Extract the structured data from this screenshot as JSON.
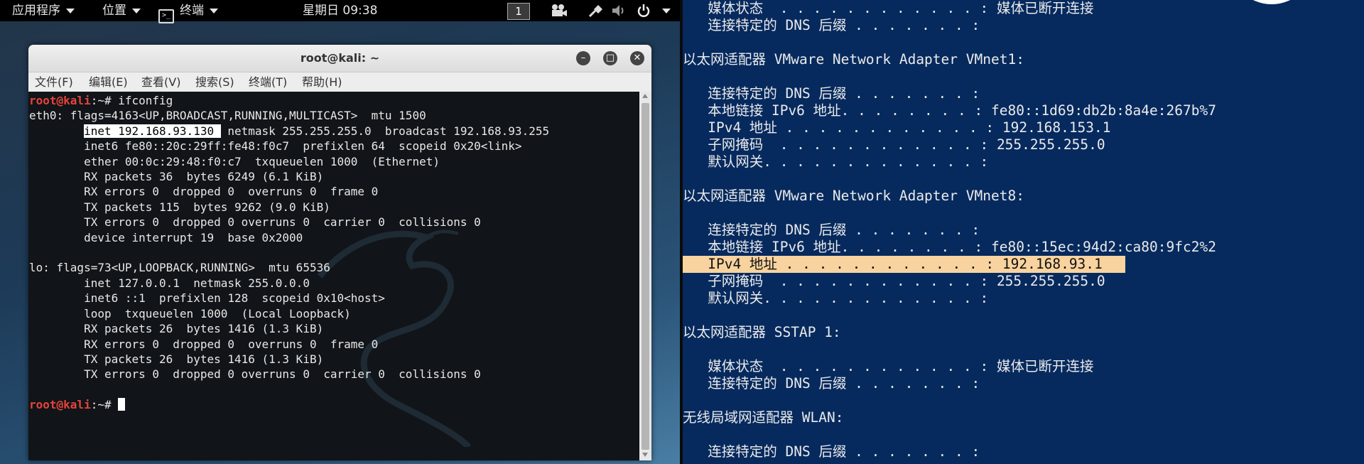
{
  "topbar": {
    "apps_label": "应用程序",
    "places_label": "位置",
    "terminal_label": "终端",
    "clock": "星期日 09:38",
    "workspace": "1"
  },
  "terminal": {
    "title": "root@kali: ~",
    "menu": [
      "文件(F)",
      "编辑(E)",
      "查看(V)",
      "搜索(S)",
      "终端(T)",
      "帮助(H)"
    ],
    "prompt_user": "root@kali",
    "prompt_suffix": ":~# ",
    "command": "ifconfig",
    "eth0_header": "eth0: flags=4163<UP,BROADCAST,RUNNING,MULTICAST>  mtu 1500",
    "eth0_inet_highlight": "inet 192.168.93.130 ",
    "eth0_inet_rest": " netmask 255.255.255.0  broadcast 192.168.93.255",
    "eth0_lines": [
      "inet6 fe80::20c:29ff:fe48:f0c7  prefixlen 64  scopeid 0x20<link>",
      "ether 00:0c:29:48:f0:c7  txqueuelen 1000  (Ethernet)",
      "RX packets 36  bytes 6249 (6.1 KiB)",
      "RX errors 0  dropped 0  overruns 0  frame 0",
      "TX packets 115  bytes 9262 (9.0 KiB)",
      "TX errors 0  dropped 0 overruns 0  carrier 0  collisions 0",
      "device interrupt 19  base 0x2000"
    ],
    "lo_header": "lo: flags=73<UP,LOOPBACK,RUNNING>  mtu 65536",
    "lo_lines": [
      "inet 127.0.0.1  netmask 255.0.0.0",
      "inet6 ::1  prefixlen 128  scopeid 0x10<host>",
      "loop  txqueuelen 1000  (Local Loopback)",
      "RX packets 26  bytes 1416 (1.3 KiB)",
      "RX errors 0  dropped 0  overruns 0  frame 0",
      "TX packets 26  bytes 1416 (1.3 KiB)",
      "TX errors 0  dropped 0 overruns 0  carrier 0  collisions 0"
    ]
  },
  "cmd": {
    "lines": [
      "   媒体状态  . . . . . . . . . . . . : 媒体已断开连接",
      "   连接特定的 DNS 后缀 . . . . . . . :",
      "",
      "以太网适配器 VMware Network Adapter VMnet1:",
      "",
      "   连接特定的 DNS 后缀 . . . . . . . :",
      "   本地链接 IPv6 地址. . . . . . . . : fe80::1d69:db2b:8a4e:267b%7",
      "   IPv4 地址 . . . . . . . . . . . . : 192.168.153.1",
      "   子网掩码  . . . . . . . . . . . . : 255.255.255.0",
      "   默认网关. . . . . . . . . . . . . :",
      "",
      "以太网适配器 VMware Network Adapter VMnet8:",
      "",
      "   连接特定的 DNS 后缀 . . . . . . . :",
      "   本地链接 IPv6 地址. . . . . . . . : fe80::15ec:94d2:ca80:9fc2%2",
      "   IPv4 地址 . . . . . . . . . . . . : 192.168.93.1",
      "   子网掩码  . . . . . . . . . . . . : 255.255.255.0",
      "   默认网关. . . . . . . . . . . . . :",
      "",
      "以太网适配器 SSTAP 1:",
      "",
      "   媒体状态  . . . . . . . . . . . . : 媒体已断开连接",
      "   连接特定的 DNS 后缀 . . . . . . . :",
      "",
      "无线局域网适配器 WLAN:",
      "",
      "   连接特定的 DNS 后缀 . . . . . . . :"
    ],
    "highlight_index": 15
  }
}
